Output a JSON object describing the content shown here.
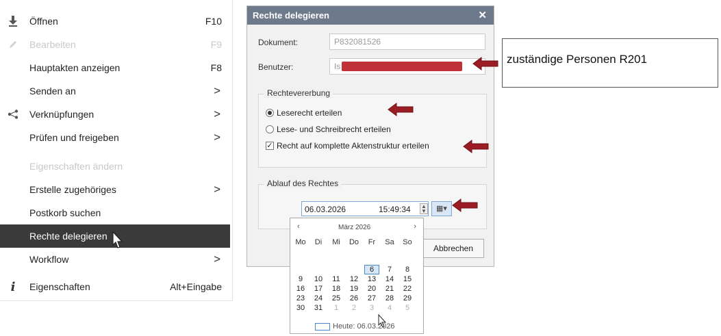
{
  "context_menu": {
    "items": [
      {
        "label": "Öffnen",
        "shortcut": "F10",
        "icon": "download-icon"
      },
      {
        "label": "Bearbeiten",
        "shortcut": "F9",
        "icon": "edit-icon",
        "disabled": true
      },
      {
        "label": "Hauptakten anzeigen",
        "shortcut": "F8"
      },
      {
        "label": "Senden an",
        "submenu": ">"
      },
      {
        "label": "Verknüpfungen",
        "submenu": ">",
        "icon": "share-icon"
      },
      {
        "label": "Prüfen und freigeben",
        "submenu": ">"
      },
      {
        "label": "Eigenschaften ändern",
        "disabled": true
      },
      {
        "label": "Erstelle zugehöriges",
        "submenu": ">"
      },
      {
        "label": "Postkorb suchen"
      },
      {
        "label": "Rechte delegieren",
        "active": true
      },
      {
        "label": "Workflow",
        "submenu": ">"
      },
      {
        "label": "Eigenschaften",
        "shortcut": "Alt+Eingabe",
        "icon": "info-icon"
      }
    ]
  },
  "dialog": {
    "title": "Rechte delegieren",
    "close": "✕",
    "dokument_label": "Dokument:",
    "dokument_value": "P832081526",
    "benutzer_label": "Benutzer:",
    "benutzer_value": "Is",
    "vererbung_legend": "Rechtevererbung",
    "option_read": "Leserecht erteilen",
    "option_readwrite": "Lese- und Schreibrecht erteilen",
    "option_full_structure": "Recht auf komplette Aktenstruktur erteilen",
    "ablauf_legend": "Ablauf des Rechtes",
    "date_value": "06.03.2026",
    "time_value": "15:49:34",
    "cancel_label": "Abbrechen"
  },
  "calendar": {
    "prev": "‹",
    "next": "›",
    "month_label": "März 2026",
    "weekdays": [
      "Mo",
      "Di",
      "Mi",
      "Do",
      "Fr",
      "Sa",
      "So"
    ],
    "rows": [
      [
        "",
        "",
        "",
        "",
        "",
        "",
        ""
      ],
      [
        "",
        "",
        "",
        "",
        "6",
        "7",
        "8"
      ],
      [
        "9",
        "10",
        "11",
        "12",
        "13",
        "14",
        "15"
      ],
      [
        "16",
        "17",
        "18",
        "19",
        "20",
        "21",
        "22"
      ],
      [
        "23",
        "24",
        "25",
        "26",
        "27",
        "28",
        "29"
      ],
      [
        "30",
        "31",
        "1",
        "2",
        "3",
        "4",
        "5"
      ]
    ],
    "today_label": "Heute: 06.03.2026"
  },
  "callout": {
    "text": "zuständige Personen R201"
  },
  "colors": {
    "arrow": "#9b1c22",
    "redaction": "#c0313a",
    "active_menu_bg": "#3a3a3a"
  }
}
